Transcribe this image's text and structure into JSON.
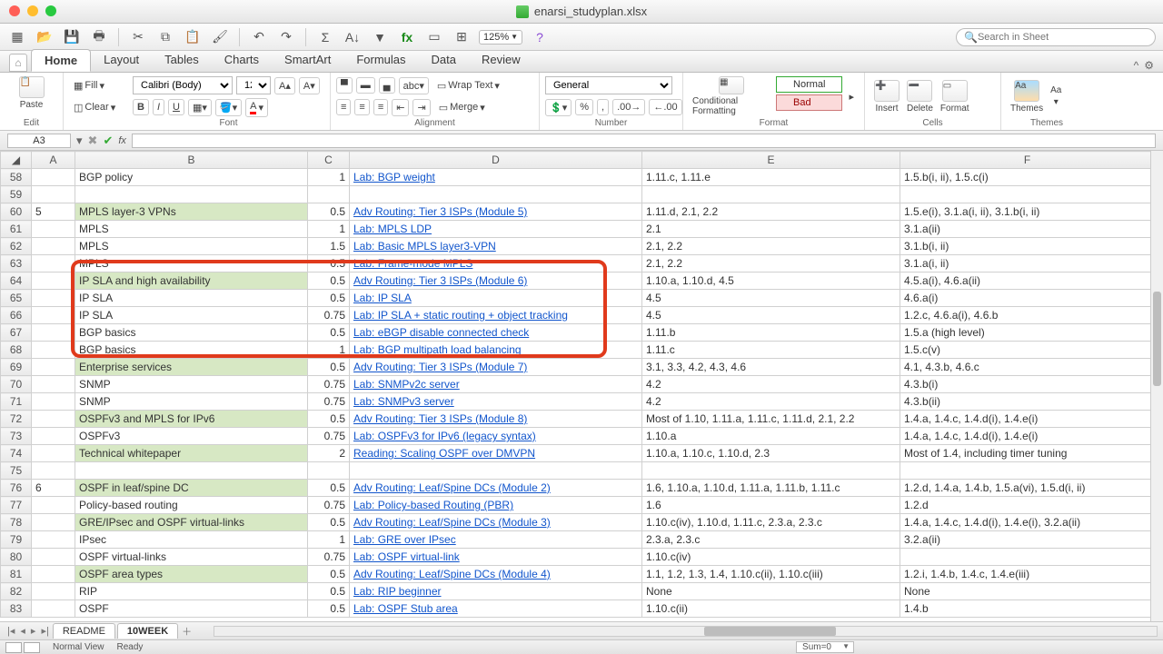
{
  "window": {
    "title": "enarsi_studyplan.xlsx"
  },
  "toolbar": {
    "zoom": "125%",
    "search_placeholder": "Search in Sheet"
  },
  "ribbon_tabs": [
    "Home",
    "Layout",
    "Tables",
    "Charts",
    "SmartArt",
    "Formulas",
    "Data",
    "Review"
  ],
  "ribbon": {
    "edit": {
      "label": "Edit",
      "fill": "Fill",
      "clear": "Clear",
      "paste": "Paste"
    },
    "font": {
      "label": "Font",
      "name": "Calibri (Body)",
      "size": "12"
    },
    "alignment": {
      "label": "Alignment",
      "wrap": "Wrap Text",
      "merge": "Merge"
    },
    "number": {
      "label": "Number",
      "format": "General"
    },
    "format": {
      "label": "Format",
      "cond": "Conditional Formatting",
      "normal": "Normal",
      "bad": "Bad"
    },
    "cells": {
      "label": "Cells",
      "insert": "Insert",
      "delete": "Delete",
      "format": "Format"
    },
    "themes": {
      "label": "Themes",
      "themes": "Themes",
      "aa": "Aa"
    }
  },
  "namebox": {
    "ref": "A3",
    "fx": "fx"
  },
  "columns": [
    "A",
    "B",
    "C",
    "D",
    "E",
    "F"
  ],
  "rows": [
    {
      "n": "58",
      "B": "BGP policy",
      "C": "1",
      "D": "Lab: BGP weight",
      "E": "1.11.c, 1.11.e",
      "F": "1.5.b(i, ii), 1.5.c(i)"
    },
    {
      "n": "59"
    },
    {
      "n": "60",
      "A": "5",
      "B": "MPLS layer-3 VPNs",
      "Bg": 1,
      "C": "0.5",
      "D": "Adv Routing: Tier 3 ISPs (Module 5)",
      "E": "1.11.d, 2.1, 2.2",
      "F": "1.5.e(i), 3.1.a(i, ii), 3.1.b(i, ii)"
    },
    {
      "n": "61",
      "B": "MPLS",
      "C": "1",
      "D": "Lab: MPLS LDP",
      "E": "2.1",
      "F": "3.1.a(ii)"
    },
    {
      "n": "62",
      "B": "MPLS",
      "C": "1.5",
      "D": "Lab: Basic MPLS layer3-VPN",
      "E": "2.1, 2.2",
      "F": "3.1.b(i, ii)"
    },
    {
      "n": "63",
      "B": "MPLS",
      "C": "0.5",
      "D": "Lab: Frame-mode MPLS",
      "E": "2.1, 2.2",
      "F": "3.1.a(i, ii)"
    },
    {
      "n": "64",
      "B": "IP SLA and high availability",
      "Bg": 1,
      "C": "0.5",
      "D": "Adv Routing: Tier 3 ISPs (Module 6)",
      "E": "1.10.a, 1.10.d, 4.5",
      "F": "4.5.a(i), 4.6.a(ii)"
    },
    {
      "n": "65",
      "B": "IP SLA",
      "C": "0.5",
      "D": "Lab: IP SLA",
      "E": "4.5",
      "F": "4.6.a(i)"
    },
    {
      "n": "66",
      "B": "IP SLA",
      "C": "0.75",
      "D": "Lab: IP SLA + static routing + object tracking",
      "E": "4.5",
      "F": "1.2.c, 4.6.a(i), 4.6.b"
    },
    {
      "n": "67",
      "B": "BGP basics",
      "C": "0.5",
      "D": "Lab: eBGP disable connected check",
      "E": "1.11.b",
      "F": "1.5.a (high level)"
    },
    {
      "n": "68",
      "B": "BGP basics",
      "C": "1",
      "D": "Lab: BGP multipath load balancing",
      "E": "1.11.c",
      "F": "1.5.c(v)"
    },
    {
      "n": "69",
      "B": "Enterprise services",
      "Bg": 1,
      "C": "0.5",
      "D": "Adv Routing: Tier 3 ISPs (Module 7)",
      "E": "3.1, 3.3, 4.2, 4.3, 4.6",
      "F": "4.1, 4.3.b, 4.6.c"
    },
    {
      "n": "70",
      "B": "SNMP",
      "C": "0.75",
      "D": "Lab: SNMPv2c server",
      "E": "4.2",
      "F": "4.3.b(i)"
    },
    {
      "n": "71",
      "B": "SNMP",
      "C": "0.75",
      "D": "Lab: SNMPv3 server",
      "E": "4.2",
      "F": "4.3.b(ii)"
    },
    {
      "n": "72",
      "B": "OSPFv3 and MPLS for IPv6",
      "Bg": 1,
      "C": "0.5",
      "D": "Adv Routing: Tier 3 ISPs (Module 8)",
      "E": "Most of 1.10, 1.11.a, 1.11.c, 1.11.d, 2.1, 2.2",
      "F": "1.4.a, 1.4.c, 1.4.d(i), 1.4.e(i)"
    },
    {
      "n": "73",
      "B": "OSPFv3",
      "C": "0.75",
      "D": "Lab: OSPFv3 for IPv6 (legacy syntax)",
      "E": "1.10.a",
      "F": "1.4.a, 1.4.c, 1.4.d(i), 1.4.e(i)"
    },
    {
      "n": "74",
      "B": "Technical whitepaper",
      "Bg": 1,
      "C": "2",
      "D": "Reading: Scaling OSPF over DMVPN",
      "E": "1.10.a, 1.10.c, 1.10.d, 2.3",
      "F": "Most of 1.4, including timer tuning"
    },
    {
      "n": "75"
    },
    {
      "n": "76",
      "A": "6",
      "B": "OSPF in leaf/spine DC",
      "Bg": 1,
      "C": "0.5",
      "D": "Adv Routing: Leaf/Spine DCs (Module 2)",
      "E": "1.6, 1.10.a, 1.10.d, 1.11.a, 1.11.b, 1.11.c",
      "F": "1.2.d, 1.4.a, 1.4.b, 1.5.a(vi), 1.5.d(i, ii)"
    },
    {
      "n": "77",
      "B": "Policy-based routing",
      "C": "0.75",
      "D": "Lab: Policy-based Routing (PBR)",
      "E": "1.6",
      "F": "1.2.d"
    },
    {
      "n": "78",
      "B": "GRE/IPsec and OSPF virtual-links",
      "Bg": 1,
      "C": "0.5",
      "D": "Adv Routing: Leaf/Spine DCs (Module 3)",
      "E": "1.10.c(iv), 1.10.d, 1.11.c, 2.3.a, 2.3.c",
      "F": "1.4.a, 1.4.c, 1.4.d(i), 1.4.e(i), 3.2.a(ii)"
    },
    {
      "n": "79",
      "B": "IPsec",
      "C": "1",
      "D": "Lab: GRE over IPsec",
      "E": "2.3.a, 2.3.c",
      "F": "3.2.a(ii)"
    },
    {
      "n": "80",
      "B": "OSPF virtual-links",
      "C": "0.75",
      "D": "Lab: OSPF virtual-link",
      "E": "1.10.c(iv)",
      "F": ""
    },
    {
      "n": "81",
      "B": "OSPF area types",
      "Bg": 1,
      "C": "0.5",
      "D": "Adv Routing: Leaf/Spine DCs (Module 4)",
      "E": "1.1, 1.2, 1.3, 1.4, 1.10.c(ii), 1.10.c(iii)",
      "F": "1.2.i, 1.4.b, 1.4.c, 1.4.e(iii)"
    },
    {
      "n": "82",
      "B": "RIP",
      "C": "0.5",
      "D": "Lab: RIP beginner",
      "E": "None",
      "F": "None"
    },
    {
      "n": "83",
      "B": "OSPF",
      "C": "0.5",
      "D": "Lab: OSPF Stub area",
      "E": "1.10.c(ii)",
      "F": "1.4.b"
    }
  ],
  "sheet_tabs": [
    "README",
    "10WEEK"
  ],
  "status": {
    "view": "Normal View",
    "ready": "Ready",
    "sum": "Sum=0"
  }
}
